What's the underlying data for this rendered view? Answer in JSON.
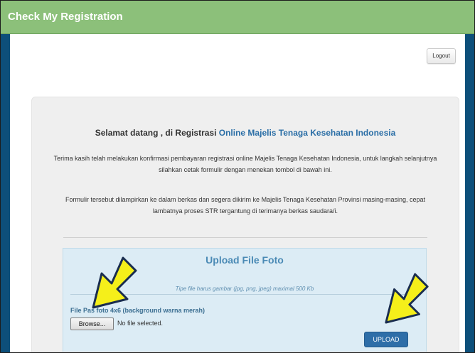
{
  "window": {
    "title": "Check My Registration"
  },
  "header": {
    "logout_label": "Logout"
  },
  "welcome": {
    "prefix": "Selamat datang , di Registrasi ",
    "highlight": "Online Majelis Tenaga Kesehatan Indonesia"
  },
  "paragraphs": [
    "Terima kasih telah melakukan konfirmasi pembayaran registrasi online Majelis Tenaga Kesehatan Indonesia, untuk langkah selanjutnya silahkan cetak formulir dengan menekan tombol di bawah ini.",
    "Formulir tersebut dilampirkan ke dalam berkas dan segera dikirim ke Majelis Tenaga Kesehatan Provinsi masing-masing, cepat lambatnya proses STR tergantung di terimanya berkas saudara/i."
  ],
  "upload": {
    "title": "Upload File Foto",
    "hint": "Tipe file harus gambar (jpg, png, jpeg) maximal 500 Kb",
    "field_label": "File Pas foto 4x6 (background warna merah)",
    "browse_label": "Browse...",
    "file_status": "No file selected.",
    "upload_label": "UPLOAD"
  },
  "annotations": {
    "arrow_color": "#f5ef1a",
    "arrow_outline": "#1a2d4f"
  },
  "colors": {
    "titlebar": "#8cc07a",
    "frame": "#0d4f7a",
    "accent": "#2e6ea8"
  }
}
